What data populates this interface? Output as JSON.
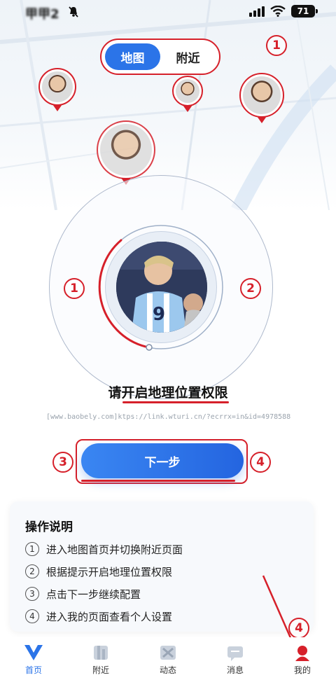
{
  "status_bar": {
    "time": "甲甲2",
    "battery": "71"
  },
  "toggle": {
    "map_label": "地图",
    "nearby_label": "附近"
  },
  "annotations": {
    "one": "1",
    "two": "2",
    "three": "3",
    "four": "4"
  },
  "permission": {
    "title": "请开启地理位置权限",
    "url": "[www.baobely.com]ktps://link.wturi.cn/?ecrrx=in&id=4978588-ang=zh]"
  },
  "next_button": {
    "label": "下一步"
  },
  "instructions": {
    "title": "操作说明",
    "steps": [
      {
        "num": "1",
        "text": "进入地图首页并切换附近页面"
      },
      {
        "num": "2",
        "text": "根据提示开启地理位置权限"
      },
      {
        "num": "3",
        "text": "点击下一步继续配置"
      },
      {
        "num": "4",
        "text": "进入我的页面查看个人设置"
      }
    ]
  },
  "bottom_nav": [
    {
      "label": "首页",
      "icon": "home-v-icon",
      "active": true
    },
    {
      "label": "附近",
      "icon": "nearby-icon",
      "active": false
    },
    {
      "label": "动态",
      "icon": "feed-icon",
      "active": false
    },
    {
      "label": "消息",
      "icon": "message-icon",
      "active": false
    },
    {
      "label": "我的",
      "icon": "profile-icon",
      "active": false
    }
  ],
  "colors": {
    "accent": "#2b74e8",
    "annotation_red": "#d6202a"
  }
}
